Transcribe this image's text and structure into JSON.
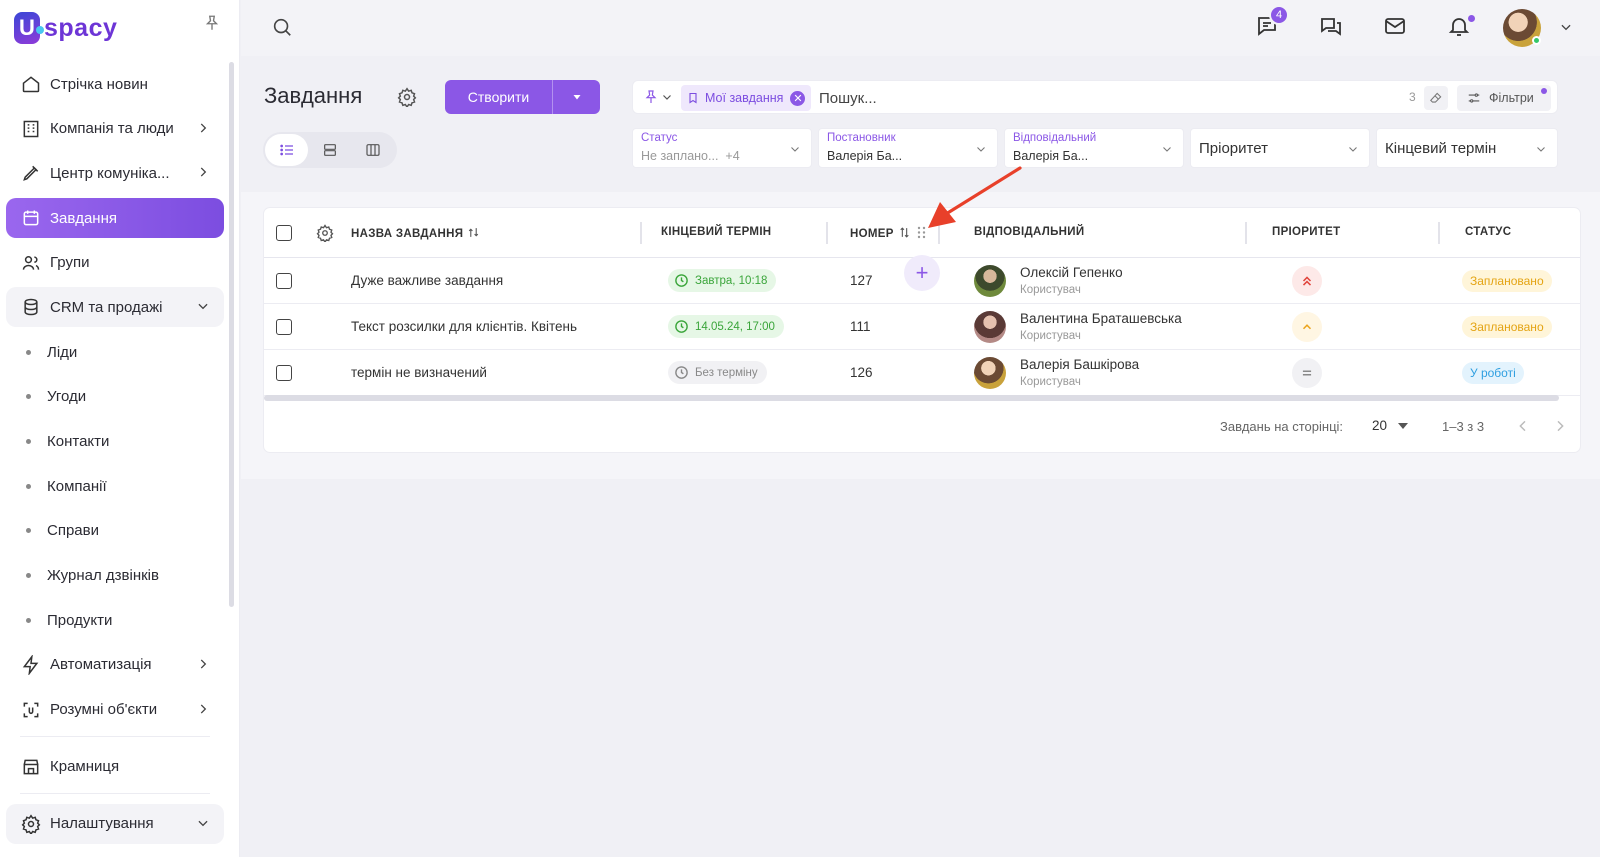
{
  "brand": {
    "logo_letter": "U",
    "logo_text": "spacy"
  },
  "sidebar": {
    "items": [
      {
        "label": "Стрічка новин",
        "icon": "home-icon"
      },
      {
        "label": "Компанія та люди",
        "icon": "building-icon"
      },
      {
        "label": "Центр комуніка...",
        "icon": "communication-icon"
      },
      {
        "label": "Завдання",
        "icon": "calendar-icon",
        "active": true
      },
      {
        "label": "Групи",
        "icon": "users-icon"
      },
      {
        "label": "CRM та продажі",
        "icon": "database-icon",
        "expanded": true
      }
    ],
    "crm_subitems": [
      "Ліди",
      "Угоди",
      "Контакти",
      "Компанії",
      "Справи",
      "Журнал дзвінків",
      "Продукти"
    ],
    "bottom_items": [
      {
        "label": "Автоматизація",
        "icon": "lightning-icon"
      },
      {
        "label": "Розумні об'єкти",
        "icon": "smart-object-icon"
      },
      {
        "label": "Крамниця",
        "icon": "store-icon"
      },
      {
        "label": "Налаштування",
        "icon": "gear-icon"
      }
    ]
  },
  "topbar": {
    "chat_badge": "4"
  },
  "header": {
    "title": "Завдання",
    "create_label": "Створити",
    "search_placeholder": "Пошук...",
    "chip_label": "Мої завдання",
    "filter_count": "3",
    "filters_label": "Фільтри"
  },
  "filters": {
    "status_label": "Статус",
    "status_value": "Не заплано...",
    "status_more": "+4",
    "author_label": "Постановник",
    "author_value": "Валерія Ба...",
    "responsible_label": "Відповідальний",
    "responsible_value": "Валерія Ба...",
    "priority_placeholder": "Пріоритет",
    "deadline_placeholder": "Кінцевий термін"
  },
  "table": {
    "columns": {
      "name": "НАЗВА ЗАВДАННЯ",
      "deadline": "КІНЦЕВИЙ ТЕРМІН",
      "number": "НОМЕР",
      "responsible": "ВІДПОВІДАЛЬНИЙ",
      "priority": "ПРІОРИТЕТ",
      "status": "СТАТУС"
    },
    "rows": [
      {
        "name": "Дуже важливе завдання",
        "deadline": "Завтра, 10:18",
        "deadline_kind": "green",
        "number": "127",
        "responsible": "Олексій Гепенко",
        "role": "Користувач",
        "priority": "high",
        "status": "Заплановано",
        "status_kind": "planned"
      },
      {
        "name": "Текст розсилки для клієнтів. Квітень",
        "deadline": "14.05.24, 17:00",
        "deadline_kind": "green",
        "number": "111",
        "responsible": "Валентина Браташевська",
        "role": "Користувач",
        "priority": "medium",
        "status": "Заплановано",
        "status_kind": "planned"
      },
      {
        "name": "термін не визначений",
        "deadline": "Без терміну",
        "deadline_kind": "gray",
        "number": "126",
        "responsible": "Валерія Башкірова",
        "role": "Користувач",
        "priority": "normal",
        "status": "У роботі",
        "status_kind": "work"
      }
    ]
  },
  "pagination": {
    "per_page_label": "Завдань на сторінці:",
    "per_page": "20",
    "range": "1–3 з 3"
  },
  "colors": {
    "accent": "#8b57e6",
    "planned": "#e4a414",
    "in_work": "#2f9fe0",
    "deadline_green": "#3aa53a",
    "priority_high": "#e0443c",
    "annotation_arrow": "#e8402a"
  }
}
